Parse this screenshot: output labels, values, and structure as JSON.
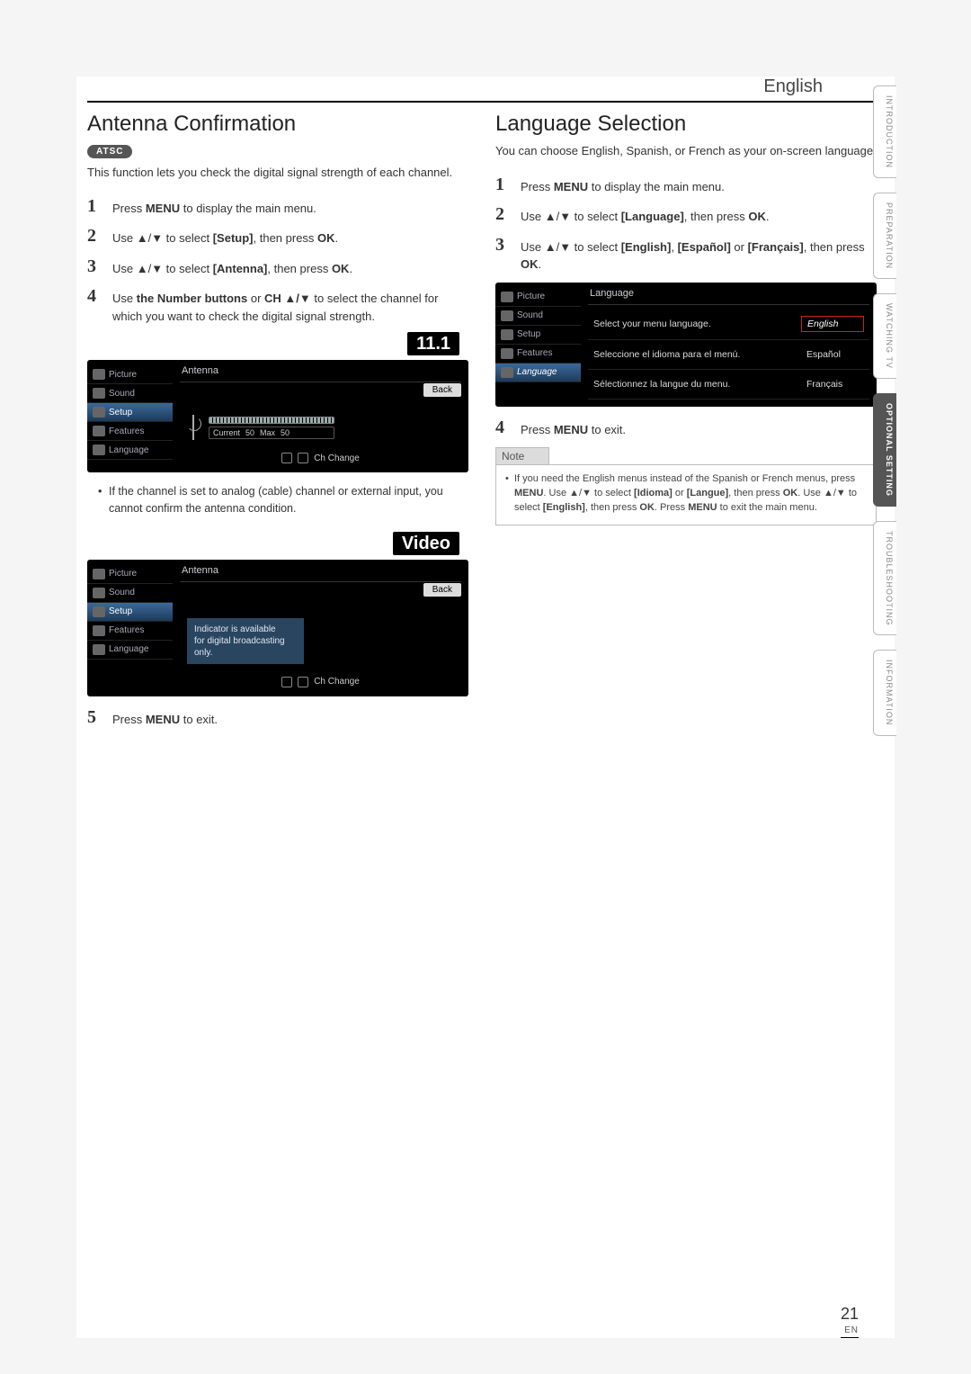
{
  "header": {
    "language": "English"
  },
  "sidetabs": {
    "items": [
      {
        "label": "INTRODUCTION"
      },
      {
        "label": "PREPARATION"
      },
      {
        "label": "WATCHING TV"
      },
      {
        "label": "OPTIONAL SETTING"
      },
      {
        "label": "TROUBLESHOOTING"
      },
      {
        "label": "INFORMATION"
      }
    ],
    "active_index": 3
  },
  "left": {
    "title": "Antenna Confirmation",
    "badge": "ATSC",
    "lead": "This function lets you check the digital signal strength of each channel.",
    "steps": [
      {
        "n": "1",
        "html": "Press <b>MENU</b> to display the main menu."
      },
      {
        "n": "2",
        "html": "Use ▲/▼ to select <b>[Setup]</b>, then press <b>OK</b>."
      },
      {
        "n": "3",
        "html": "Use ▲/▼ to select <b>[Antenna]</b>, then press <b>OK</b>."
      },
      {
        "n": "4",
        "html": "Use <b>the Number buttons</b> or <b>CH ▲/▼</b> to select the channel for which you want to check the digital signal strength."
      }
    ],
    "osd1": {
      "channel_badge": "11.1",
      "title": "Antenna",
      "back": "Back",
      "menu": [
        "Picture",
        "Sound",
        "Setup",
        "Features",
        "Language"
      ],
      "signal": {
        "current_label": "Current",
        "current": "50",
        "max_label": "Max",
        "max": "50"
      },
      "footer": "Ch Change"
    },
    "bullet1": "If the channel is set to analog (cable) channel or external input, you cannot confirm the antenna condition.",
    "osd2": {
      "channel_badge": "Video",
      "title": "Antenna",
      "back": "Back",
      "menu": [
        "Picture",
        "Sound",
        "Setup",
        "Features",
        "Language"
      ],
      "indicator_lines": [
        "Indicator is available",
        "for digital broadcasting",
        "only."
      ],
      "footer": "Ch Change"
    },
    "step5": {
      "n": "5",
      "html": "Press <b>MENU</b> to exit."
    }
  },
  "right": {
    "title": "Language Selection",
    "lead": "You can choose English, Spanish, or French as your on-screen language.",
    "steps": [
      {
        "n": "1",
        "html": "Press <b>MENU</b> to display the main menu."
      },
      {
        "n": "2",
        "html": "Use ▲/▼ to select <b>[Language]</b>, then press <b>OK</b>."
      },
      {
        "n": "3",
        "html": "Use ▲/▼ to select <b>[English]</b>, <b>[Español]</b> or <b>[Français]</b>, then press <b>OK</b>."
      }
    ],
    "osd": {
      "title": "Language",
      "menu": [
        "Picture",
        "Sound",
        "Setup",
        "Features",
        "Language"
      ],
      "rows": [
        {
          "desc": "Select your menu language.",
          "val": "English",
          "sel": true
        },
        {
          "desc": "Seleccione el idioma para el menú.",
          "val": "Español",
          "sel": false
        },
        {
          "desc": "Sélectionnez la langue du menu.",
          "val": "Français",
          "sel": false
        }
      ]
    },
    "step4": {
      "n": "4",
      "html": "Press <b>MENU</b> to exit."
    },
    "note": {
      "header": "Note",
      "body": "If you need the English menus instead of the Spanish or French menus, press <b>MENU</b>. Use ▲/▼ to select <b>[Idioma]</b> or <b>[Langue]</b>, then press <b>OK</b>. Use ▲/▼ to select <b>[English]</b>, then press <b>OK</b>. Press <b>MENU</b> to exit the main menu."
    }
  },
  "page_number": {
    "num": "21",
    "en": "EN"
  }
}
